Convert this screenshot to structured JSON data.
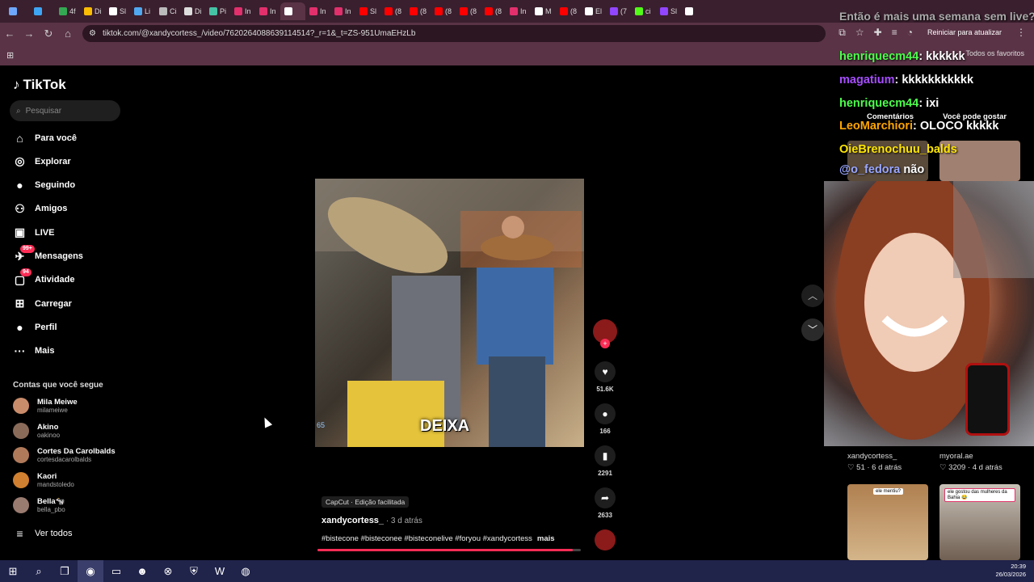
{
  "browser": {
    "tabs": [
      {
        "label": "",
        "icon": "settings-icon",
        "color": "#6ea8fe"
      },
      {
        "label": "",
        "icon": "diamond-icon",
        "color": "#3da5f4"
      },
      {
        "label": "4f",
        "icon": "drive-icon",
        "color": "#34a853"
      },
      {
        "label": "Di",
        "icon": "drive-icon",
        "color": "#fbbc04"
      },
      {
        "label": "Sl",
        "icon": "letter-s-icon",
        "color": "#ffffff"
      },
      {
        "label": "Li",
        "icon": "cloud-icon",
        "color": "#4fa8f0"
      },
      {
        "label": "Ci",
        "icon": "c-icon",
        "color": "#bbbbbb"
      },
      {
        "label": "Di",
        "icon": "d-icon",
        "color": "#dddddd"
      },
      {
        "label": "Pi",
        "icon": "link-icon",
        "color": "#46c3a5"
      },
      {
        "label": "In",
        "icon": "instagram-icon",
        "color": "#e1306c"
      },
      {
        "label": "In",
        "icon": "instagram-icon",
        "color": "#e1306c"
      },
      {
        "label": "",
        "icon": "tiktok-icon",
        "color": "#ffffff"
      },
      {
        "label": "In",
        "icon": "instagram-icon",
        "color": "#e1306c"
      },
      {
        "label": "In",
        "icon": "instagram-icon",
        "color": "#e1306c"
      },
      {
        "label": "Sl",
        "icon": "youtube-icon",
        "color": "#ff0000"
      },
      {
        "label": "(8",
        "icon": "youtube-icon",
        "color": "#ff0000"
      },
      {
        "label": "(8",
        "icon": "youtube-icon",
        "color": "#ff0000"
      },
      {
        "label": "(8",
        "icon": "youtube-icon",
        "color": "#ff0000"
      },
      {
        "label": "(8",
        "icon": "youtube-icon",
        "color": "#ff0000"
      },
      {
        "label": "(8",
        "icon": "youtube-icon",
        "color": "#ff0000"
      },
      {
        "label": "In",
        "icon": "instagram-icon",
        "color": "#e1306c"
      },
      {
        "label": "M",
        "icon": "tiktok-icon",
        "color": "#ffffff"
      },
      {
        "label": "(8",
        "icon": "youtube-icon",
        "color": "#ff0000"
      },
      {
        "label": "El",
        "icon": "tiktok-icon",
        "color": "#ffffff"
      },
      {
        "label": "(7",
        "icon": "twitch-icon",
        "color": "#9146ff"
      },
      {
        "label": "ci",
        "icon": "kick-icon",
        "color": "#53fc18"
      },
      {
        "label": "Sl",
        "icon": "twitch-icon",
        "color": "#9146ff"
      },
      {
        "label": "",
        "icon": "letter-s-icon",
        "color": "#ffffff"
      }
    ],
    "url": "tiktok.com/@xandycortess_/video/7620264088639114514?_r=1&_t=ZS-951UmaEHzLb",
    "reboot_label": "Reiniciar para atualizar",
    "favorites_label": "Todos os favoritos"
  },
  "tiktok": {
    "logo": "TikTok",
    "search_placeholder": "Pesquisar",
    "nav": [
      {
        "label": "Para você",
        "icon": "home-icon",
        "glyph": "⌂"
      },
      {
        "label": "Explorar",
        "icon": "compass-icon",
        "glyph": "◎"
      },
      {
        "label": "Seguindo",
        "icon": "following-avatar-icon",
        "glyph": "●"
      },
      {
        "label": "Amigos",
        "icon": "friends-icon",
        "glyph": "⚇"
      },
      {
        "label": "LIVE",
        "icon": "live-icon",
        "glyph": "▣"
      },
      {
        "label": "Mensagens",
        "icon": "messages-icon",
        "glyph": "✈",
        "badge": "99+"
      },
      {
        "label": "Atividade",
        "icon": "activity-icon",
        "glyph": "▢",
        "badge": "94"
      },
      {
        "label": "Carregar",
        "icon": "upload-icon",
        "glyph": "⊞"
      },
      {
        "label": "Perfil",
        "icon": "profile-avatar-icon",
        "glyph": "●"
      },
      {
        "label": "Mais",
        "icon": "more-icon",
        "glyph": "···"
      }
    ],
    "following_header": "Contas que você segue",
    "following": [
      {
        "name": "Mila Meiwe",
        "handle": "milameiwe",
        "color": "#c98c6b"
      },
      {
        "name": "Akino",
        "handle": "oakinoo",
        "color": "#8a6b5a"
      },
      {
        "name": "Cortes Da Carolbalds",
        "handle": "cortesdacarolbalds",
        "color": "#b07a5a"
      },
      {
        "name": "Kaori",
        "handle": "mandstoledo",
        "color": "#d08030"
      },
      {
        "name": "Bella🐄",
        "handle": "bella_pbo",
        "color": "#9a7b70"
      }
    ],
    "see_all": "Ver todos",
    "video": {
      "caption": "DEIXA",
      "counter": "65",
      "capcut": "CapCut · Edição facilitada",
      "author": "xandycortess_",
      "ago": " · 3 d atrás",
      "tags": "#bistecone #bisteconee #bisteconelive #foryou #xandycortess",
      "more": "mais",
      "progress": 0.97
    },
    "actions": {
      "likes": "51.6K",
      "comments": "166",
      "saves": "2291",
      "shares": "2633"
    },
    "right": {
      "tab_comments": "Comentários",
      "tab_suggested": "Você pode gostar",
      "items": [
        {
          "author": "xandycortess_",
          "meta": "♡ 51 · 6 d atrás"
        },
        {
          "author": "myoral.ae",
          "meta": "♡ 3209 · 4 d atrás"
        }
      ],
      "thumb_labels": [
        "ele mentiu?",
        "ele gostou das mulheres da Bahia 😂"
      ]
    }
  },
  "stream_overlay": {
    "title": "Então é mais uma semana sem live?",
    "chat": [
      {
        "user": "henriquecm44",
        "msg": ": kkkkkk",
        "color": "#4cff4c"
      },
      {
        "user": "magatium",
        "msg": ": kkkkkkkkkkk",
        "color": "#a64dff"
      },
      {
        "user": "henriquecm44",
        "msg": ": ixi",
        "color": "#4cff4c"
      },
      {
        "user": "LeoMarchiori",
        "msg": ": OLOCO kkkkk",
        "color": "#ffa500"
      },
      {
        "user": "OieBrenochuu_balds",
        "msg": "",
        "color": "#ffe600"
      },
      {
        "user": "@o_fedora",
        "msg": " não",
        "color": "#9aa7ff"
      }
    ]
  },
  "taskbar": {
    "items": [
      {
        "icon": "windows-start-icon",
        "glyph": "⊞"
      },
      {
        "icon": "search-icon",
        "glyph": "⌕"
      },
      {
        "icon": "task-view-icon",
        "glyph": "❐"
      },
      {
        "icon": "chrome-icon",
        "glyph": "◉"
      },
      {
        "icon": "file-explorer-icon",
        "glyph": "▭"
      },
      {
        "icon": "discord-icon",
        "glyph": "☻"
      },
      {
        "icon": "xbox-icon",
        "glyph": "⊗"
      },
      {
        "icon": "shield-icon",
        "glyph": "⛨"
      },
      {
        "icon": "word-icon",
        "glyph": "W"
      },
      {
        "icon": "obs-icon",
        "glyph": "◍"
      }
    ],
    "time": "20:39",
    "date": "26/03/2026"
  }
}
